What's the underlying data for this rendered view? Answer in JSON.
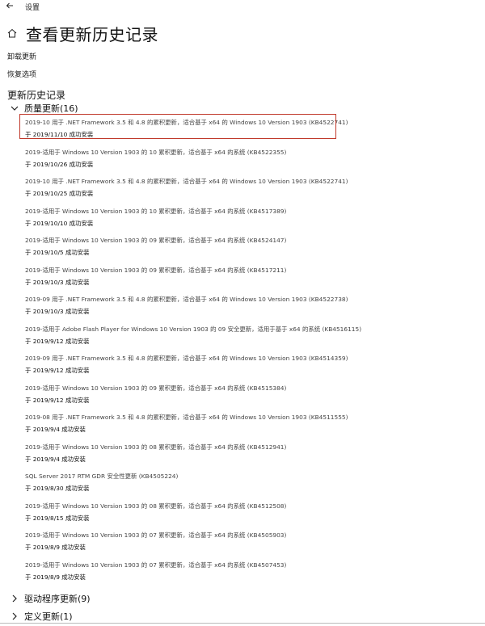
{
  "window": {
    "app_title": "设置"
  },
  "header": {
    "page_title": "查看更新历史记录"
  },
  "links": {
    "uninstall": "卸载更新",
    "recovery": "恢复选项"
  },
  "history": {
    "heading": "更新历史记录",
    "quality_group_label": "质量更新(16)",
    "driver_group_label": "驱动程序更新(9)",
    "definition_group_label": "定义更新(1)",
    "items": [
      {
        "name": "2019-10 用于 .NET Framework 3.5 和 4.8 的累积更新，适合基于 x64 的 Windows 10 Version 1903 (KB4522741)",
        "status": "于 2019/11/10 成功安装"
      },
      {
        "name": "2019-适用于 Windows 10 Version 1903 的 10 累积更新，适合基于 x64 的系统 (KB4522355)",
        "status": "于 2019/10/26 成功安装"
      },
      {
        "name": "2019-10 用于 .NET Framework 3.5 和 4.8 的累积更新，适合基于 x64 的 Windows 10 Version 1903 (KB4522741)",
        "status": "于 2019/10/25 成功安装"
      },
      {
        "name": "2019-适用于 Windows 10 Version 1903 的 10 累积更新，适合基于 x64 的系统 (KB4517389)",
        "status": "于 2019/10/10 成功安装"
      },
      {
        "name": "2019-适用于 Windows 10 Version 1903 的 09 累积更新，适合基于 x64 的系统 (KB4524147)",
        "status": "于 2019/10/5 成功安装"
      },
      {
        "name": "2019-适用于 Windows 10 Version 1903 的 09 累积更新，适合基于 x64 的系统 (KB4517211)",
        "status": "于 2019/10/3 成功安装"
      },
      {
        "name": "2019-09 用于 .NET Framework 3.5 和 4.8 的累积更新，适合基于 x64 的 Windows 10 Version 1903 (KB4522738)",
        "status": "于 2019/10/3 成功安装"
      },
      {
        "name": "2019-适用于 Adobe Flash Player for Windows 10 Version 1903 的 09 安全更新，适用于基于 x64 的系统 (KB4516115)",
        "status": "于 2019/9/12 成功安装"
      },
      {
        "name": "2019-09 用于 .NET Framework 3.5 和 4.8 的累积更新，适合基于 x64 的 Windows 10 Version 1903 (KB4514359)",
        "status": "于 2019/9/12 成功安装"
      },
      {
        "name": "2019-适用于 Windows 10 Version 1903 的 09 累积更新，适合基于 x64 的系统 (KB4515384)",
        "status": "于 2019/9/12 成功安装"
      },
      {
        "name": "2019-08 用于 .NET Framework 3.5 和 4.8 的累积更新，适合基于 x64 的 Windows 10 Version 1903 (KB4511555)",
        "status": "于 2019/9/4 成功安装"
      },
      {
        "name": "2019-适用于 Windows 10 Version 1903 的 08 累积更新，适合基于 x64 的系统 (KB4512941)",
        "status": "于 2019/9/4 成功安装"
      },
      {
        "name": "SQL Server 2017 RTM GDR 安全性更新 (KB4505224)",
        "status": "于 2019/8/30 成功安装"
      },
      {
        "name": "2019-适用于 Windows 10 Version 1903 的 08 累积更新，适合基于 x64 的系统 (KB4512508)",
        "status": "于 2019/8/15 成功安装"
      },
      {
        "name": "2019-适用于 Windows 10 Version 1903 的 07 累积更新，适合基于 x64 的系统 (KB4505903)",
        "status": "于 2019/8/9 成功安装"
      },
      {
        "name": "2019-适用于 Windows 10 Version 1903 的 07 累积更新，适合基于 x64 的系统 (KB4507453)",
        "status": "于 2019/8/9 成功安装"
      }
    ]
  },
  "colors": {
    "highlight_border": "#c0392b"
  }
}
